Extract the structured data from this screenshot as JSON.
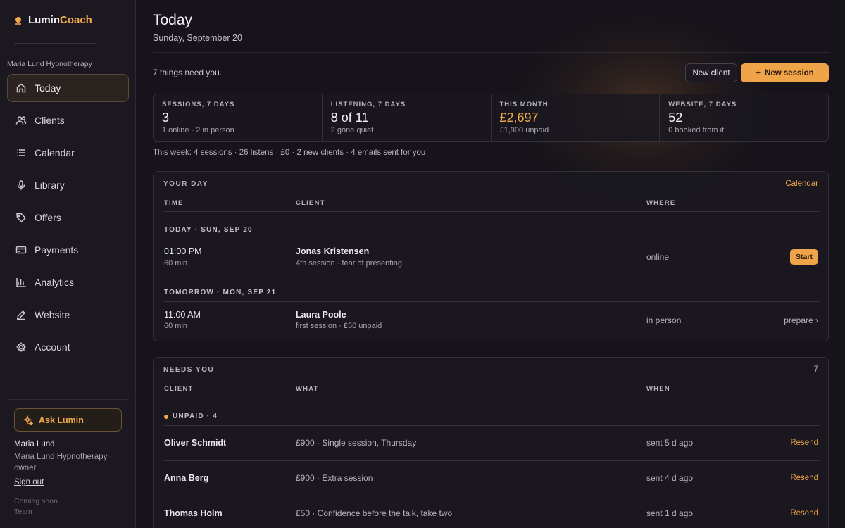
{
  "brand": {
    "part1": "Lumin",
    "part2": "Coach"
  },
  "workspace": "Maria Lund Hypnotherapy",
  "nav": {
    "items": [
      {
        "label": "Today",
        "icon": "home-icon"
      },
      {
        "label": "Clients",
        "icon": "users-icon"
      },
      {
        "label": "Calendar",
        "icon": "list-icon"
      },
      {
        "label": "Library",
        "icon": "microphone-icon"
      },
      {
        "label": "Offers",
        "icon": "tag-icon"
      },
      {
        "label": "Payments",
        "icon": "card-icon"
      },
      {
        "label": "Analytics",
        "icon": "bar-chart-icon"
      },
      {
        "label": "Website",
        "icon": "edit-icon"
      },
      {
        "label": "Account",
        "icon": "gear-icon"
      }
    ]
  },
  "ask_button": "Ask Lumin",
  "user": {
    "name": "Maria Lund",
    "org": "Maria Lund Hypnotherapy · owner",
    "sign_out": "Sign out"
  },
  "coming_soon": {
    "label": "Coming soon",
    "item": "Team"
  },
  "header": {
    "title": "Today",
    "date": "Sunday, September 20",
    "needs_summary": "7 things need you.",
    "new_client": "New client",
    "new_session": "New session"
  },
  "stats": [
    {
      "label": "SESSIONS, 7 DAYS",
      "value": "3",
      "sub": "1 online · 2 in person"
    },
    {
      "label": "LISTENING, 7 DAYS",
      "value": "8 of 11",
      "sub": "2 gone quiet"
    },
    {
      "label": "THIS MONTH",
      "value": "£2,697",
      "sub": "£1,900 unpaid"
    },
    {
      "label": "WEBSITE, 7 DAYS",
      "value": "52",
      "sub": "0 booked from it"
    }
  ],
  "week_summary": "This week: 4 sessions · 26 listens · £0 · 2 new clients · 4 emails sent for you",
  "your_day": {
    "title": "YOUR DAY",
    "link": "Calendar",
    "columns": {
      "time": "TIME",
      "client": "CLIENT",
      "where": "WHERE"
    },
    "groups": [
      {
        "label": "TODAY · SUN, SEP 20",
        "time": "01:00 PM",
        "duration": "60 min",
        "client": "Jonas Kristensen",
        "detail": "4th session · fear of presenting",
        "where": "online",
        "action": "Start"
      },
      {
        "label": "TOMORROW · MON, SEP 21",
        "time": "11:00 AM",
        "duration": "60 min",
        "client": "Laura Poole",
        "detail": "first session · £50 unpaid",
        "where": "in person",
        "action": "prepare ›"
      }
    ]
  },
  "needs_you": {
    "title": "NEEDS YOU",
    "count": "7",
    "columns": {
      "client": "CLIENT",
      "what": "WHAT",
      "when": "WHEN"
    },
    "group_label": "UNPAID · 4",
    "rows": [
      {
        "client": "Oliver Schmidt",
        "what": "£900 · Single session, Thursday",
        "when": "sent 5 d ago",
        "action": "Resend"
      },
      {
        "client": "Anna Berg",
        "what": "£900 · Extra session",
        "when": "sent 4 d ago",
        "action": "Resend"
      },
      {
        "client": "Thomas Holm",
        "what": "£50 · Confidence before the talk, take two",
        "when": "sent 1 d ago",
        "action": "Resend"
      }
    ]
  },
  "colors": {
    "accent": "#f2a84a",
    "background": "#16131a",
    "sidebar": "#1b1820"
  }
}
